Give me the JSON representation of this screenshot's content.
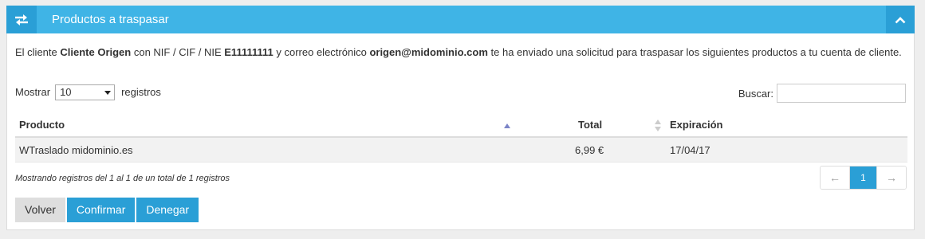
{
  "panel": {
    "title": "Productos a traspasar",
    "icon": "transfer-arrows-icon",
    "toggle_icon": "chevron-up-icon"
  },
  "intro": {
    "t1": "El cliente ",
    "client": "Cliente Origen",
    "t2": " con NIF / CIF / NIE ",
    "nif": "E11111111",
    "t3": " y correo electrónico ",
    "email": "origen@midominio.com",
    "t4": " te ha enviado una solicitud para traspasar los siguientes productos a tu cuenta de cliente."
  },
  "length_menu": {
    "before": "Mostrar",
    "value": "10",
    "after": "registros"
  },
  "search": {
    "label": "Buscar:",
    "value": ""
  },
  "table": {
    "columns": [
      "Producto",
      "Total",
      "Expiración"
    ],
    "rows": [
      {
        "producto": "WTraslado midominio.es",
        "total": "6,99 €",
        "expiracion": "17/04/17"
      }
    ]
  },
  "info": "Mostrando registros del 1 al 1 de un total de 1 registros",
  "pagination": {
    "prev": "←",
    "current": "1",
    "next": "→"
  },
  "buttons": {
    "back": "Volver",
    "confirm": "Confirmar",
    "deny": "Denegar"
  },
  "colors": {
    "header": "#3fb4e6",
    "header_dark": "#2a9fd6",
    "accent": "#2a9fd6",
    "row_bg": "#f2f2f2"
  }
}
